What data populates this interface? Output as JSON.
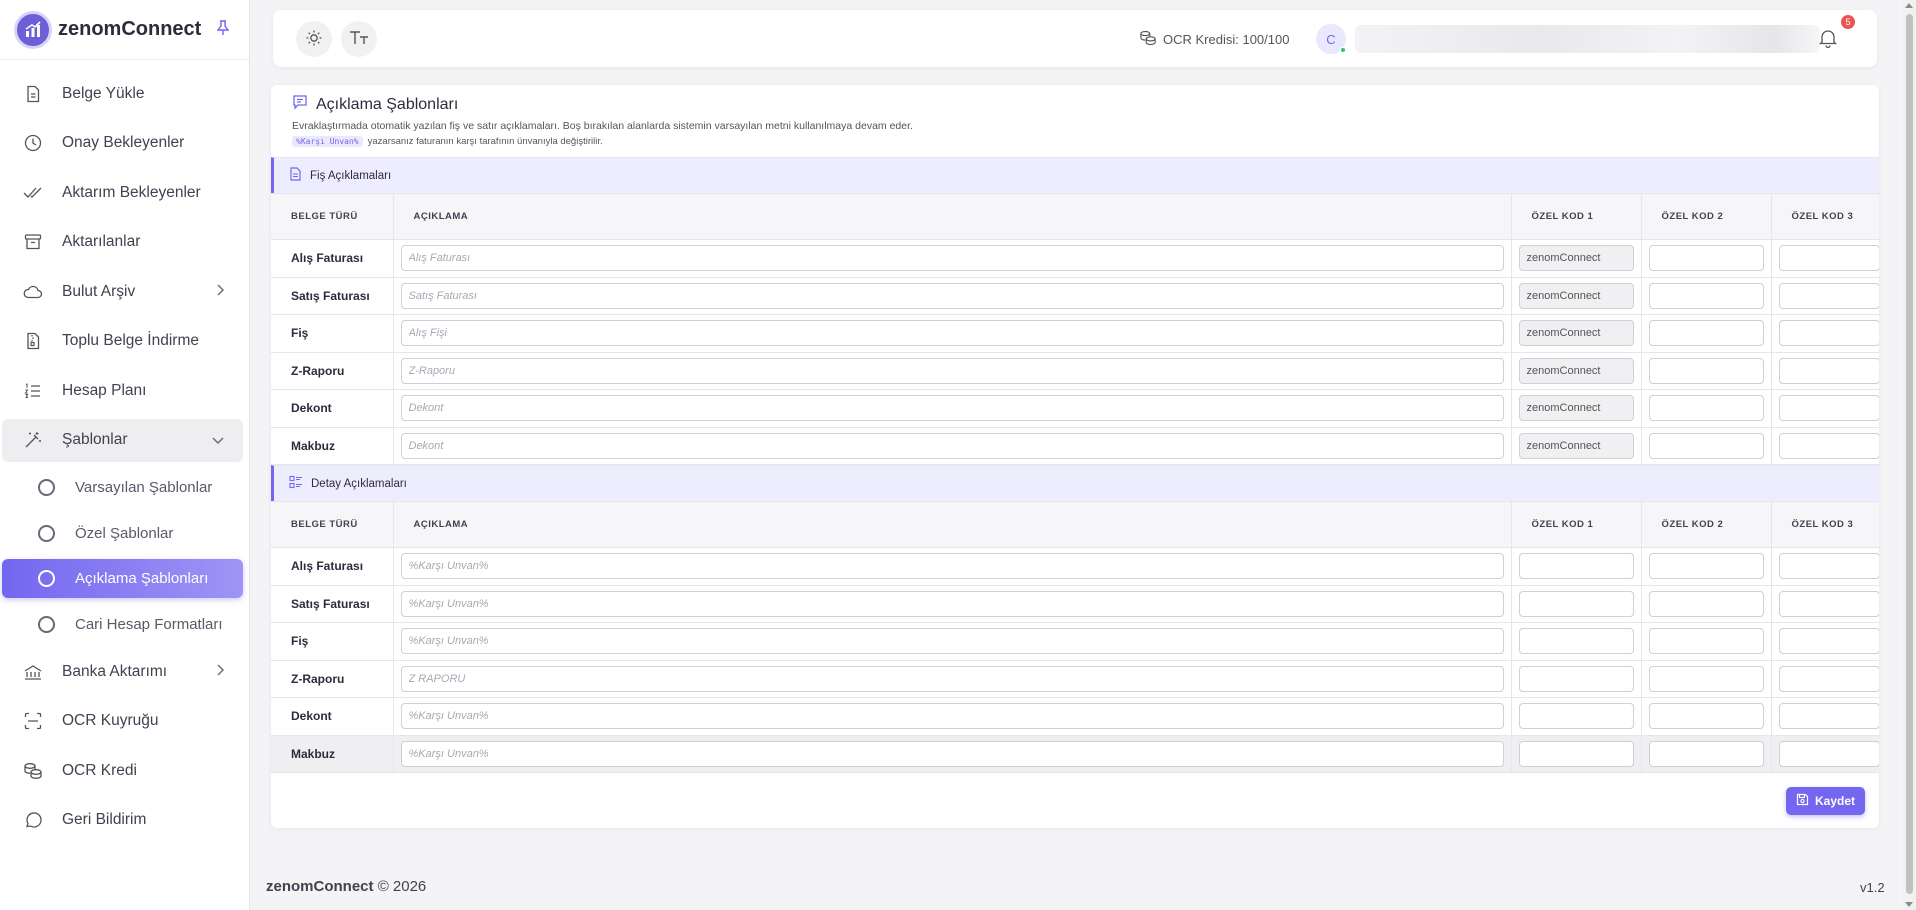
{
  "brand": {
    "name": "zenomConnect"
  },
  "sidebar": {
    "items": [
      {
        "label": "Belge Yükle",
        "icon": "file-upload-icon"
      },
      {
        "label": "Onay Bekleyenler",
        "icon": "clock-icon"
      },
      {
        "label": "Aktarım Bekleyenler",
        "icon": "double-check-icon"
      },
      {
        "label": "Aktarılanlar",
        "icon": "archive-icon"
      },
      {
        "label": "Bulut Arşiv",
        "icon": "cloud-icon"
      },
      {
        "label": "Toplu Belge İndirme",
        "icon": "file-zip-icon"
      },
      {
        "label": "Hesap Planı",
        "icon": "list-numbers-icon"
      },
      {
        "label": "Şablonlar",
        "icon": "wand-icon"
      }
    ],
    "subitems": [
      {
        "label": "Varsayılan Şablonlar"
      },
      {
        "label": "Özel Şablonlar"
      },
      {
        "label": "Açıklama Şablonları"
      },
      {
        "label": "Cari Hesap Formatları"
      }
    ],
    "items_after": [
      {
        "label": "Banka Aktarımı",
        "icon": "bank-transfer-icon"
      },
      {
        "label": "OCR Kuyruğu",
        "icon": "scan-icon"
      },
      {
        "label": "OCR Kredi",
        "icon": "coins-icon"
      },
      {
        "label": "Geri Bildirim",
        "icon": "message-circle-icon"
      }
    ]
  },
  "topbar": {
    "ocr_credit": "OCR Kredisi: 100/100",
    "avatar_initial": "C",
    "notification_count": "5"
  },
  "page": {
    "title": "Açıklama Şablonları",
    "description": "Evraklaştırmada otomatik yazılan fiş ve satır açıklamaları. Boş bırakılan alanlarda sistemin varsayılan metni kullanılmaya devam eder.",
    "chip": "%Karşı Unvan%",
    "hint": "yazarsanız faturanın karşı tarafının ünvanıyla değiştirilir.",
    "save_label": "Kaydet"
  },
  "columns": {
    "type": "BELGE TÜRÜ",
    "desc": "AÇIKLAMA",
    "k1": "ÖZEL KOD 1",
    "k2": "ÖZEL KOD 2",
    "k3": "ÖZEL KOD 3"
  },
  "fis": {
    "title": "Fiş Açıklamaları",
    "rows": [
      {
        "label": "Alış Faturası",
        "placeholder": "Alış Faturası",
        "k1": "zenomConnect"
      },
      {
        "label": "Satış Faturası",
        "placeholder": "Satış Faturası",
        "k1": "zenomConnect"
      },
      {
        "label": "Fiş",
        "placeholder": "Alış Fişi",
        "k1": "zenomConnect"
      },
      {
        "label": "Z-Raporu",
        "placeholder": "Z-Raporu",
        "k1": "zenomConnect"
      },
      {
        "label": "Dekont",
        "placeholder": "Dekont",
        "k1": "zenomConnect"
      },
      {
        "label": "Makbuz",
        "placeholder": "Dekont",
        "k1": "zenomConnect"
      }
    ]
  },
  "detay": {
    "title": "Detay Açıklamaları",
    "rows": [
      {
        "label": "Alış Faturası",
        "placeholder": "%Karşı Unvan%"
      },
      {
        "label": "Satış Faturası",
        "placeholder": "%Karşı Unvan%"
      },
      {
        "label": "Fiş",
        "placeholder": "%Karşı Unvan%"
      },
      {
        "label": "Z-Raporu",
        "placeholder": "Z RAPORU"
      },
      {
        "label": "Dekont",
        "placeholder": "%Karşı Unvan%"
      },
      {
        "label": "Makbuz",
        "placeholder": "%Karşı Unvan%"
      }
    ]
  },
  "footer": {
    "brand": "zenomConnect",
    "copyright": "© 2026",
    "version": "v1.2"
  },
  "colors": {
    "accent": "#7367f0",
    "danger": "#ea5455",
    "online": "#28c76f"
  }
}
